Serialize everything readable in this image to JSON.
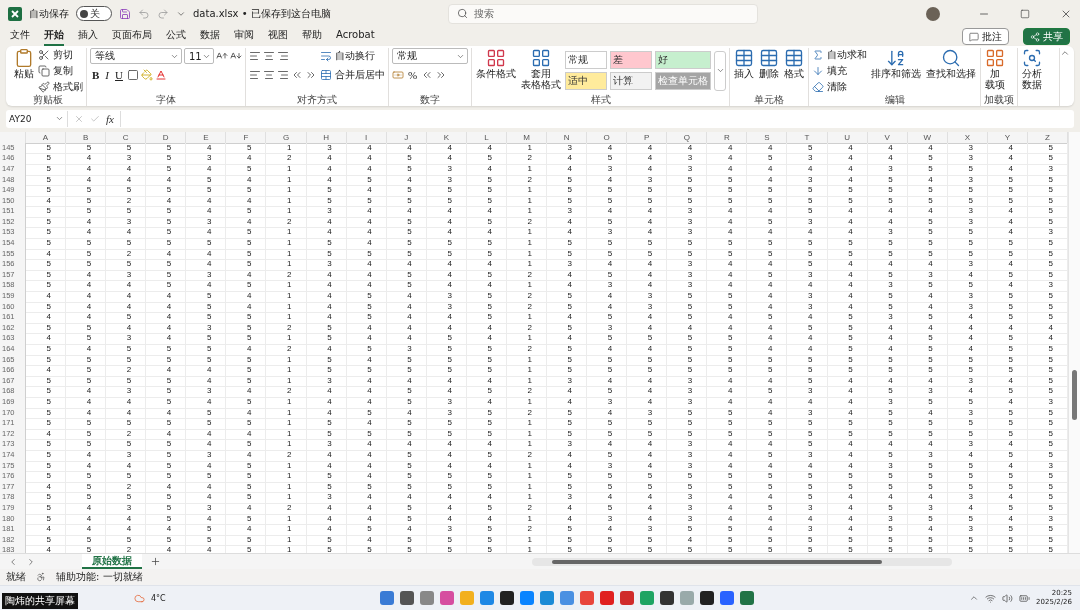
{
  "titlebar": {
    "autosave_label": "自动保存",
    "autosave": {
      "on": false,
      "label": "关"
    },
    "filename": "data.xlsx • 已保存到这台电脑",
    "search_placeholder": "搜索"
  },
  "menu_tabs": [
    {
      "label": "文件",
      "selected": false
    },
    {
      "label": "开始",
      "selected": true
    },
    {
      "label": "插入",
      "selected": false
    },
    {
      "label": "页面布局",
      "selected": false
    },
    {
      "label": "公式",
      "selected": false
    },
    {
      "label": "数据",
      "selected": false
    },
    {
      "label": "审阅",
      "selected": false
    },
    {
      "label": "视图",
      "selected": false
    },
    {
      "label": "帮助",
      "selected": false
    },
    {
      "label": "Acrobat",
      "selected": false
    }
  ],
  "header_buttons": [
    {
      "kind": "comment",
      "label": "批注"
    },
    {
      "kind": "share",
      "label": "共享"
    }
  ],
  "ribbon": {
    "groups": [
      {
        "kind": "clipboard",
        "title": "剪贴板",
        "paste": {
          "lines": [
            "粘贴"
          ]
        },
        "actions": [
          "剪切",
          "复制",
          "格式刷"
        ]
      },
      {
        "kind": "font",
        "title": "字体",
        "font": "等线",
        "size": "11",
        "bold": "B",
        "italic": "I",
        "underline": "U"
      },
      {
        "kind": "alignment",
        "title": "对齐方式",
        "actions": [
          "自动换行",
          "合并后居中"
        ]
      },
      {
        "kind": "number",
        "title": "数字",
        "format": "常规",
        "percent": "%"
      },
      {
        "kind": "styles",
        "title": "样式",
        "buttons": [
          {
            "lines": [
              "条件格式"
            ]
          },
          {
            "lines": [
              "套用",
              "表格格式"
            ]
          }
        ],
        "cell_styles": [
          {
            "label": "常规",
            "color": "#ffffff"
          },
          {
            "label": "差",
            "color": "#ffc7ce"
          },
          {
            "label": "好",
            "color": "#c6efce"
          },
          {
            "label": "适中",
            "color": "#ffeb9c"
          },
          {
            "label": "计算",
            "color": "#f2f2f2"
          },
          {
            "label": "检查单元格",
            "color": "#a5a5a5"
          }
        ]
      },
      {
        "kind": "cells",
        "title": "单元格",
        "buttons": [
          {
            "lines": [
              "插入"
            ]
          },
          {
            "lines": [
              "删除"
            ]
          },
          {
            "lines": [
              "格式"
            ]
          }
        ]
      },
      {
        "kind": "editing",
        "title": "编辑",
        "actions": [
          "自动求和",
          "填充",
          "清除"
        ],
        "buttons": [
          {
            "lines": [
              "排序和筛选"
            ]
          },
          {
            "lines": [
              "查找和选择"
            ]
          }
        ]
      },
      {
        "kind": "addins",
        "title": "加载项",
        "buttons": [
          {
            "lines": [
              "加",
              "载项"
            ]
          }
        ]
      },
      {
        "kind": "analyze",
        "buttons": [
          {
            "lines": [
              "分析",
              "数据"
            ]
          }
        ]
      }
    ]
  },
  "formula_bar": {
    "name_box": "AY20",
    "function_label": "fx"
  },
  "sheet": {
    "columns": [
      "A",
      "B",
      "C",
      "D",
      "E",
      "F",
      "G",
      "H",
      "I",
      "J",
      "K",
      "L",
      "M",
      "N",
      "O",
      "P",
      "Q",
      "R",
      "S",
      "T",
      "U",
      "V",
      "W",
      "X",
      "Y",
      "Z"
    ],
    "rows": [
      {
        "number": "145",
        "cells": [
          "5",
          "5",
          "5",
          "5",
          "4",
          "5",
          "1",
          "3",
          "4",
          "4",
          "4",
          "4",
          "1",
          "3",
          "4",
          "4",
          "4",
          "4",
          "4",
          "5",
          "4",
          "4",
          "4",
          "3",
          "4",
          "5"
        ]
      },
      {
        "number": "146",
        "cells": [
          "5",
          "4",
          "3",
          "5",
          "3",
          "4",
          "2",
          "4",
          "4",
          "5",
          "4",
          "5",
          "2",
          "4",
          "5",
          "4",
          "3",
          "4",
          "5",
          "3",
          "4",
          "4",
          "5",
          "3",
          "4",
          "5"
        ]
      },
      {
        "number": "147",
        "cells": [
          "5",
          "4",
          "4",
          "5",
          "4",
          "5",
          "1",
          "4",
          "4",
          "5",
          "3",
          "4",
          "1",
          "4",
          "3",
          "4",
          "3",
          "4",
          "4",
          "4",
          "4",
          "3",
          "5",
          "5",
          "4",
          "3"
        ]
      },
      {
        "number": "148",
        "cells": [
          "5",
          "4",
          "4",
          "4",
          "5",
          "4",
          "1",
          "4",
          "5",
          "4",
          "3",
          "5",
          "2",
          "5",
          "4",
          "3",
          "5",
          "5",
          "4",
          "3",
          "4",
          "5",
          "4",
          "3",
          "5",
          "5"
        ]
      },
      {
        "number": "149",
        "cells": [
          "5",
          "5",
          "5",
          "5",
          "5",
          "5",
          "1",
          "5",
          "4",
          "5",
          "5",
          "5",
          "1",
          "5",
          "5",
          "5",
          "5",
          "5",
          "5",
          "5",
          "5",
          "5",
          "5",
          "5",
          "5",
          "5"
        ]
      },
      {
        "number": "150",
        "cells": [
          "4",
          "5",
          "2",
          "4",
          "4",
          "4",
          "1",
          "5",
          "5",
          "5",
          "5",
          "5",
          "1",
          "5",
          "5",
          "5",
          "5",
          "5",
          "5",
          "5",
          "5",
          "5",
          "5",
          "5",
          "5",
          "5"
        ]
      },
      {
        "number": "151",
        "cells": [
          "5",
          "5",
          "5",
          "5",
          "4",
          "5",
          "1",
          "3",
          "4",
          "4",
          "4",
          "4",
          "1",
          "3",
          "4",
          "4",
          "3",
          "4",
          "4",
          "5",
          "4",
          "4",
          "4",
          "3",
          "4",
          "5"
        ]
      },
      {
        "number": "152",
        "cells": [
          "5",
          "4",
          "3",
          "5",
          "3",
          "4",
          "2",
          "4",
          "4",
          "5",
          "4",
          "5",
          "2",
          "4",
          "5",
          "4",
          "3",
          "4",
          "5",
          "3",
          "4",
          "4",
          "5",
          "3",
          "4",
          "5"
        ]
      },
      {
        "number": "153",
        "cells": [
          "5",
          "4",
          "4",
          "5",
          "4",
          "5",
          "1",
          "4",
          "4",
          "5",
          "4",
          "4",
          "1",
          "4",
          "3",
          "4",
          "3",
          "4",
          "4",
          "4",
          "4",
          "3",
          "5",
          "5",
          "4",
          "3"
        ]
      },
      {
        "number": "154",
        "cells": [
          "5",
          "5",
          "5",
          "5",
          "5",
          "5",
          "1",
          "5",
          "4",
          "5",
          "5",
          "5",
          "1",
          "5",
          "5",
          "5",
          "5",
          "5",
          "5",
          "5",
          "5",
          "5",
          "5",
          "5",
          "5",
          "5"
        ]
      },
      {
        "number": "155",
        "cells": [
          "4",
          "5",
          "2",
          "4",
          "4",
          "5",
          "1",
          "5",
          "5",
          "5",
          "5",
          "5",
          "1",
          "5",
          "5",
          "5",
          "5",
          "5",
          "5",
          "5",
          "5",
          "5",
          "5",
          "5",
          "5",
          "5"
        ]
      },
      {
        "number": "156",
        "cells": [
          "5",
          "5",
          "5",
          "5",
          "4",
          "5",
          "1",
          "3",
          "4",
          "4",
          "4",
          "4",
          "1",
          "3",
          "4",
          "4",
          "3",
          "4",
          "4",
          "5",
          "4",
          "4",
          "4",
          "3",
          "4",
          "5"
        ]
      },
      {
        "number": "157",
        "cells": [
          "5",
          "4",
          "3",
          "5",
          "3",
          "4",
          "2",
          "4",
          "4",
          "5",
          "4",
          "5",
          "2",
          "4",
          "5",
          "4",
          "3",
          "4",
          "5",
          "3",
          "4",
          "5",
          "3",
          "4",
          "5",
          "5"
        ]
      },
      {
        "number": "158",
        "cells": [
          "5",
          "4",
          "4",
          "5",
          "4",
          "5",
          "1",
          "4",
          "4",
          "5",
          "4",
          "4",
          "1",
          "4",
          "3",
          "4",
          "3",
          "4",
          "4",
          "4",
          "4",
          "3",
          "5",
          "5",
          "4",
          "3"
        ]
      },
      {
        "number": "159",
        "cells": [
          "4",
          "4",
          "4",
          "4",
          "5",
          "4",
          "1",
          "4",
          "5",
          "4",
          "3",
          "5",
          "2",
          "5",
          "4",
          "3",
          "5",
          "5",
          "4",
          "3",
          "4",
          "5",
          "4",
          "3",
          "5",
          "5"
        ]
      },
      {
        "number": "160",
        "cells": [
          "5",
          "4",
          "4",
          "4",
          "5",
          "4",
          "1",
          "4",
          "5",
          "4",
          "3",
          "5",
          "2",
          "5",
          "4",
          "3",
          "5",
          "5",
          "4",
          "3",
          "4",
          "5",
          "4",
          "3",
          "5",
          "5"
        ]
      },
      {
        "number": "161",
        "cells": [
          "4",
          "4",
          "5",
          "4",
          "5",
          "5",
          "1",
          "4",
          "5",
          "4",
          "4",
          "5",
          "1",
          "4",
          "5",
          "4",
          "5",
          "4",
          "5",
          "4",
          "5",
          "3",
          "5",
          "4",
          "5",
          "5"
        ]
      },
      {
        "number": "162",
        "cells": [
          "5",
          "5",
          "4",
          "4",
          "3",
          "5",
          "2",
          "5",
          "4",
          "4",
          "4",
          "4",
          "2",
          "5",
          "3",
          "4",
          "4",
          "4",
          "4",
          "5",
          "5",
          "4",
          "4",
          "4",
          "4",
          "4"
        ]
      },
      {
        "number": "163",
        "cells": [
          "4",
          "5",
          "3",
          "4",
          "5",
          "5",
          "1",
          "5",
          "4",
          "4",
          "5",
          "4",
          "1",
          "4",
          "5",
          "5",
          "5",
          "5",
          "4",
          "4",
          "5",
          "4",
          "5",
          "4",
          "5",
          "4"
        ]
      },
      {
        "number": "164",
        "cells": [
          "5",
          "4",
          "5",
          "5",
          "5",
          "4",
          "2",
          "4",
          "5",
          "3",
          "5",
          "5",
          "2",
          "5",
          "4",
          "4",
          "5",
          "5",
          "4",
          "4",
          "5",
          "4",
          "5",
          "4",
          "5",
          "5"
        ]
      },
      {
        "number": "165",
        "cells": [
          "5",
          "5",
          "5",
          "5",
          "5",
          "5",
          "1",
          "5",
          "4",
          "5",
          "5",
          "5",
          "1",
          "5",
          "5",
          "5",
          "5",
          "5",
          "5",
          "5",
          "5",
          "5",
          "5",
          "5",
          "5",
          "5"
        ]
      },
      {
        "number": "166",
        "cells": [
          "4",
          "5",
          "2",
          "4",
          "4",
          "5",
          "1",
          "5",
          "5",
          "5",
          "5",
          "5",
          "1",
          "5",
          "5",
          "5",
          "5",
          "5",
          "5",
          "5",
          "5",
          "5",
          "5",
          "5",
          "5",
          "5"
        ]
      },
      {
        "number": "167",
        "cells": [
          "5",
          "5",
          "5",
          "5",
          "4",
          "5",
          "1",
          "3",
          "4",
          "4",
          "4",
          "4",
          "1",
          "3",
          "4",
          "4",
          "3",
          "4",
          "4",
          "5",
          "4",
          "4",
          "4",
          "3",
          "4",
          "5"
        ]
      },
      {
        "number": "168",
        "cells": [
          "5",
          "4",
          "3",
          "5",
          "3",
          "4",
          "2",
          "4",
          "4",
          "5",
          "4",
          "5",
          "2",
          "4",
          "5",
          "4",
          "3",
          "4",
          "5",
          "3",
          "4",
          "5",
          "3",
          "4",
          "5",
          "5"
        ]
      },
      {
        "number": "169",
        "cells": [
          "5",
          "4",
          "4",
          "5",
          "4",
          "5",
          "1",
          "4",
          "4",
          "5",
          "3",
          "4",
          "1",
          "4",
          "3",
          "4",
          "3",
          "4",
          "4",
          "4",
          "4",
          "3",
          "5",
          "5",
          "4",
          "3"
        ]
      },
      {
        "number": "170",
        "cells": [
          "5",
          "4",
          "4",
          "4",
          "5",
          "4",
          "1",
          "4",
          "5",
          "4",
          "3",
          "5",
          "2",
          "5",
          "4",
          "3",
          "5",
          "5",
          "4",
          "3",
          "4",
          "5",
          "4",
          "3",
          "5",
          "5"
        ]
      },
      {
        "number": "171",
        "cells": [
          "5",
          "5",
          "5",
          "5",
          "5",
          "5",
          "1",
          "5",
          "4",
          "5",
          "5",
          "5",
          "1",
          "5",
          "5",
          "5",
          "5",
          "5",
          "5",
          "5",
          "5",
          "5",
          "5",
          "5",
          "5",
          "5"
        ]
      },
      {
        "number": "172",
        "cells": [
          "4",
          "5",
          "2",
          "4",
          "4",
          "4",
          "1",
          "5",
          "5",
          "5",
          "5",
          "5",
          "1",
          "5",
          "5",
          "5",
          "5",
          "5",
          "5",
          "5",
          "5",
          "5",
          "5",
          "5",
          "5",
          "5"
        ]
      },
      {
        "number": "173",
        "cells": [
          "5",
          "5",
          "5",
          "5",
          "4",
          "5",
          "1",
          "3",
          "4",
          "4",
          "4",
          "4",
          "1",
          "3",
          "4",
          "4",
          "3",
          "4",
          "4",
          "5",
          "4",
          "4",
          "4",
          "3",
          "4",
          "5"
        ]
      },
      {
        "number": "174",
        "cells": [
          "5",
          "4",
          "3",
          "5",
          "3",
          "4",
          "2",
          "4",
          "4",
          "5",
          "4",
          "5",
          "2",
          "4",
          "5",
          "4",
          "3",
          "4",
          "5",
          "3",
          "4",
          "5",
          "3",
          "4",
          "5",
          "5"
        ]
      },
      {
        "number": "175",
        "cells": [
          "5",
          "4",
          "4",
          "5",
          "4",
          "5",
          "1",
          "4",
          "4",
          "5",
          "4",
          "4",
          "1",
          "4",
          "3",
          "4",
          "3",
          "4",
          "4",
          "4",
          "4",
          "3",
          "5",
          "5",
          "4",
          "3"
        ]
      },
      {
        "number": "176",
        "cells": [
          "5",
          "5",
          "5",
          "5",
          "5",
          "5",
          "1",
          "5",
          "4",
          "5",
          "5",
          "5",
          "1",
          "5",
          "5",
          "5",
          "5",
          "5",
          "5",
          "5",
          "5",
          "5",
          "5",
          "5",
          "5",
          "5"
        ]
      },
      {
        "number": "177",
        "cells": [
          "4",
          "5",
          "2",
          "4",
          "4",
          "5",
          "1",
          "5",
          "5",
          "5",
          "5",
          "5",
          "1",
          "5",
          "5",
          "5",
          "5",
          "5",
          "5",
          "5",
          "5",
          "5",
          "5",
          "5",
          "5",
          "5"
        ]
      },
      {
        "number": "178",
        "cells": [
          "5",
          "5",
          "5",
          "5",
          "4",
          "5",
          "1",
          "3",
          "4",
          "4",
          "4",
          "4",
          "1",
          "3",
          "4",
          "4",
          "3",
          "4",
          "4",
          "5",
          "4",
          "4",
          "4",
          "3",
          "4",
          "5"
        ]
      },
      {
        "number": "179",
        "cells": [
          "5",
          "4",
          "3",
          "5",
          "3",
          "4",
          "2",
          "4",
          "4",
          "5",
          "4",
          "5",
          "2",
          "4",
          "5",
          "4",
          "3",
          "4",
          "5",
          "3",
          "4",
          "5",
          "3",
          "4",
          "5",
          "5"
        ]
      },
      {
        "number": "180",
        "cells": [
          "5",
          "4",
          "4",
          "5",
          "4",
          "5",
          "1",
          "4",
          "4",
          "5",
          "4",
          "4",
          "1",
          "4",
          "3",
          "4",
          "3",
          "4",
          "4",
          "4",
          "4",
          "3",
          "5",
          "5",
          "4",
          "3"
        ]
      },
      {
        "number": "181",
        "cells": [
          "4",
          "4",
          "4",
          "4",
          "5",
          "4",
          "1",
          "4",
          "5",
          "4",
          "3",
          "5",
          "2",
          "5",
          "4",
          "3",
          "5",
          "5",
          "4",
          "3",
          "4",
          "5",
          "4",
          "3",
          "5",
          "5"
        ]
      },
      {
        "number": "182",
        "cells": [
          "5",
          "5",
          "5",
          "5",
          "5",
          "5",
          "1",
          "5",
          "4",
          "5",
          "5",
          "5",
          "1",
          "5",
          "5",
          "5",
          "4",
          "5",
          "5",
          "5",
          "5",
          "5",
          "5",
          "5",
          "5",
          "5"
        ]
      },
      {
        "number": "183",
        "cells": [
          "4",
          "5",
          "2",
          "4",
          "4",
          "5",
          "1",
          "5",
          "5",
          "5",
          "5",
          "5",
          "1",
          "5",
          "5",
          "5",
          "5",
          "5",
          "5",
          "5",
          "5",
          "5",
          "5",
          "5",
          "5",
          "5"
        ]
      }
    ]
  },
  "sheet_tabs": [
    {
      "label": "原始数据",
      "selected": true
    }
  ],
  "status_bar": {
    "ready": "就绪",
    "accessibility": "辅助功能: 一切就绪"
  },
  "taskbar": {
    "weather": "4°C",
    "time": "20:25",
    "date": "2025/2/26"
  },
  "share_overlay": "陶炜的共享屏幕"
}
